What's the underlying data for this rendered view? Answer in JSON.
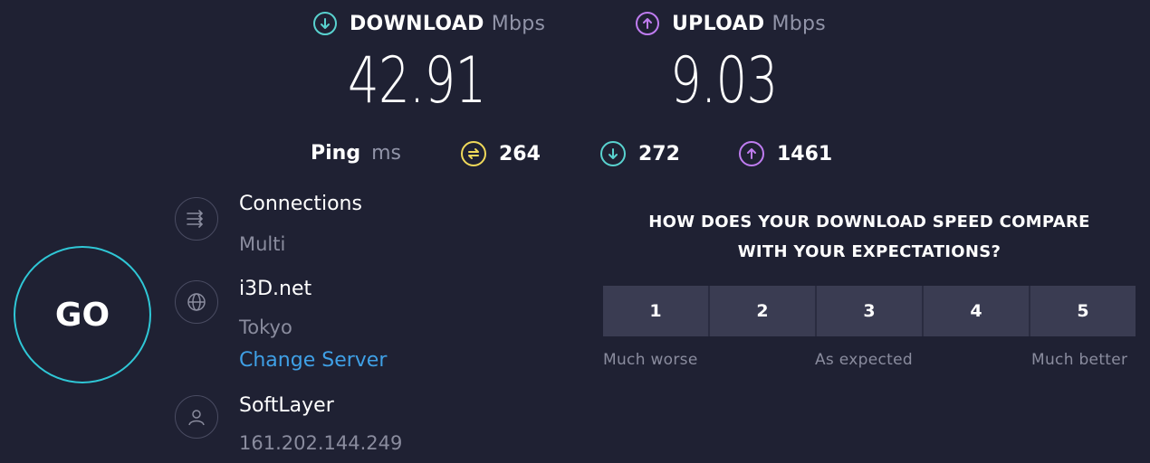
{
  "download": {
    "label": "DOWNLOAD",
    "unit": "Mbps",
    "value": "42.91",
    "icon": "arrow-down-circle-icon",
    "color": "#59d2cf"
  },
  "upload": {
    "label": "UPLOAD",
    "unit": "Mbps",
    "value": "9.03",
    "icon": "arrow-up-circle-icon",
    "color": "#bf7cf0"
  },
  "ping": {
    "label": "Ping",
    "unit": "ms",
    "idle": {
      "value": "264",
      "icon": "ping-idle-icon",
      "color": "#f0d95a"
    },
    "download": {
      "value": "272",
      "icon": "arrow-down-circle-icon",
      "color": "#59d2cf"
    },
    "upload": {
      "value": "1461",
      "icon": "arrow-up-circle-icon",
      "color": "#bf7cf0"
    }
  },
  "go_label": "GO",
  "connections": {
    "title": "Connections",
    "value": "Multi",
    "icon": "connections-icon"
  },
  "server": {
    "title": "i3D.net",
    "location": "Tokyo",
    "change_label": "Change Server",
    "icon": "globe-icon"
  },
  "provider": {
    "title": "SoftLayer",
    "ip": "161.202.144.249",
    "icon": "user-icon"
  },
  "survey": {
    "question_line1": "HOW DOES YOUR DOWNLOAD SPEED COMPARE",
    "question_line2": "WITH YOUR EXPECTATIONS?",
    "options": [
      "1",
      "2",
      "3",
      "4",
      "5"
    ],
    "scale_low": "Much worse",
    "scale_mid": "As expected",
    "scale_high": "Much better"
  }
}
